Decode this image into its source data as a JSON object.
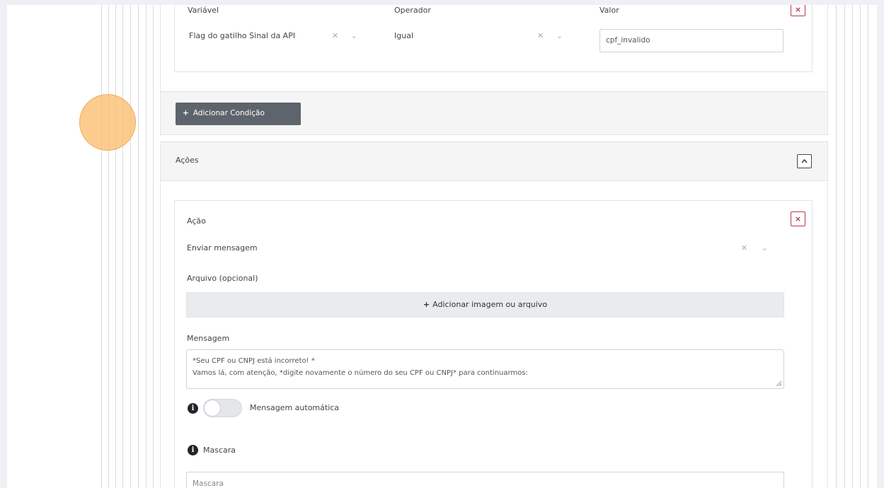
{
  "condition": {
    "variable_header": "Variável",
    "operator_header": "Operador",
    "value_header": "Valor",
    "variable_value": "Flag do gatilho Sinal da API",
    "operator_value": "Igual",
    "value_value": "cpf_invalido",
    "clear_glyph": "✕",
    "dropdown_glyph": "⌄",
    "remove_glyph": "×"
  },
  "add_condition": {
    "plus": "+",
    "label": "Adicionar Condição"
  },
  "actions_section": {
    "title": "Ações"
  },
  "action": {
    "label": "Ação",
    "value": "Enviar mensagem",
    "remove_glyph": "×",
    "file_label": "Arquivo (opcional)",
    "file_button_plus": "+",
    "file_button_label": "Adicionar imagem ou arquivo",
    "message_label": "Mensagem",
    "message_line1": "*Seu CPF ou CNPJ está incorreto! *",
    "message_line2": "Vamos lá, com atenção, *digite novamente o número do seu CPF ou CNPJ* para continuarmos:",
    "auto_message_label": "Mensagem automática",
    "auto_message_on": false,
    "info_glyph": "i",
    "mask_label": "Mascara",
    "mask_placeholder": "Mascara"
  },
  "colors": {
    "remove_button": "#b43a4a",
    "primary_button": "#5e646b",
    "cursor_highlight": "#f9be6e"
  }
}
